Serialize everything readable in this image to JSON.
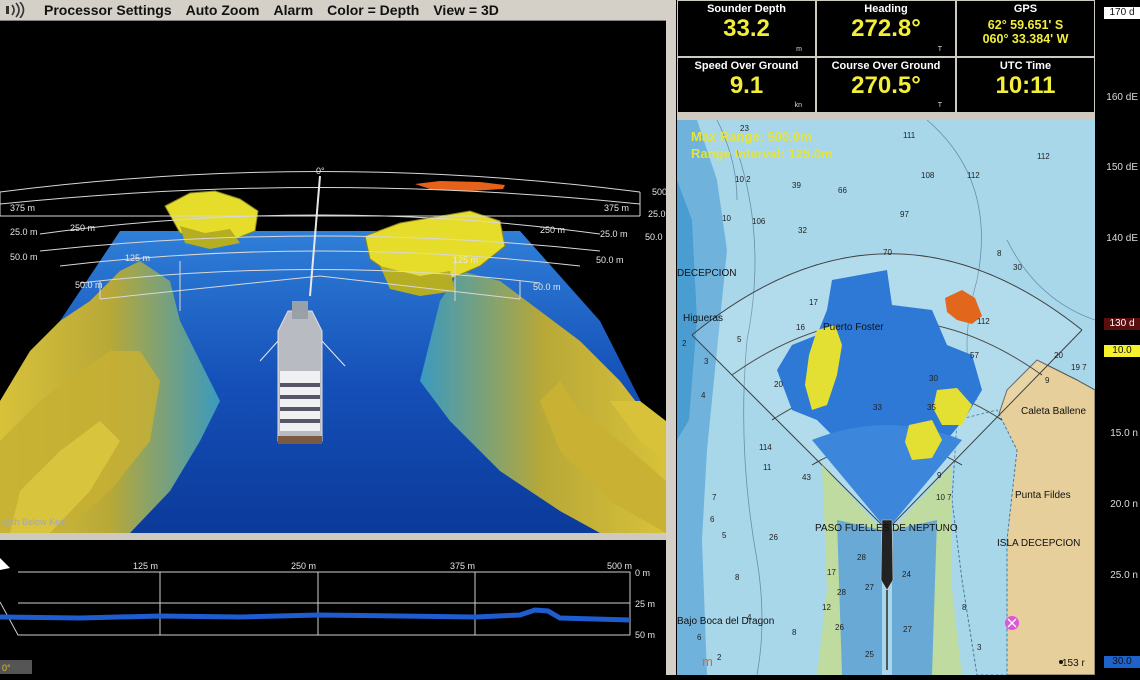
{
  "menu": {
    "signal_icon": "signal-icon",
    "items": [
      "Processor Settings",
      "Auto Zoom",
      "Alarm",
      "Color = Depth",
      "View = 3D"
    ]
  },
  "view3d": {
    "angle_label": "0°",
    "range_labels": [
      "375 m",
      "250 m",
      "125 m",
      "375 m",
      "250 m",
      "125 m"
    ],
    "depth_labels_left": [
      "25.0 m",
      "50.0 m",
      "50.0 m"
    ],
    "depth_labels_right": [
      "25.0",
      "50.0",
      "25.0 m",
      "50.0 m",
      "50.0 m"
    ],
    "top_right_label": "500",
    "overlay_label": "epth Below Keel"
  },
  "profile": {
    "range_ticks": [
      "125 m",
      "250 m",
      "375 m",
      "500 m"
    ],
    "depth_ticks": [
      "0 m",
      "25 m",
      "50 m"
    ],
    "angle_readout": "0°"
  },
  "panels": [
    {
      "label": "Sounder Depth",
      "value": "33.2",
      "unit": "m"
    },
    {
      "label": "Heading",
      "value": "272.8°",
      "unit": "T"
    },
    {
      "label": "GPS",
      "value1": "62° 59.651' S",
      "value2": "060° 33.384' W"
    },
    {
      "label": "Speed Over Ground",
      "value": "9.1",
      "unit": "kn"
    },
    {
      "label": "Course Over Ground",
      "value": "270.5°",
      "unit": "T"
    },
    {
      "label": "UTC Time",
      "value": "10:11"
    }
  ],
  "chart": {
    "max_range": "Max Range: 500.0m",
    "range_interval": "Range Interval: 125.0m",
    "place_names": [
      "DECEPCION",
      "Higueras",
      "Puerto Foster",
      "Caleta Ballene",
      "Punta Fildes",
      "ISLA DECEPCION",
      "PASO FUELLES DE NEPTUNO",
      "Bajo Boca del Dragon"
    ],
    "soundings": [
      "23",
      "111",
      "112",
      "10 2",
      "39",
      "108",
      "66",
      "97",
      "112",
      "10",
      "106",
      "32",
      "70",
      "30",
      "8",
      "20",
      "17",
      "16",
      "112",
      "57",
      "19 7",
      "9",
      "3",
      "5",
      "2",
      "4",
      "20",
      "114",
      "11",
      "7",
      "6",
      "5",
      "43",
      "10 7",
      "9",
      "28",
      "17",
      "12",
      "33",
      "30",
      "35",
      "27",
      "28",
      "26",
      "27",
      "24",
      "25",
      "26",
      "8",
      "6",
      "4",
      "2",
      "8",
      "8",
      "3",
      "153"
    ],
    "bottom_readout": "153 r",
    "m_glyph": "m"
  },
  "scale": {
    "labels": [
      "160 dE",
      "150 dE",
      "140 dE",
      "15.0 n",
      "20.0 n",
      "25.0 n"
    ],
    "top_box": "170 d",
    "red_box": "130 d",
    "yellow_box": "10.0",
    "blue_box": "30.0",
    "colors": {
      "red_box": "#5a0f0f",
      "yellow_box": "#f7f22b",
      "blue_box": "#1f62c9"
    }
  },
  "colors": {
    "accent": "#f2ee3a",
    "water_deep": "#1550b8",
    "chart_sea": "#a8d7ea",
    "land": "#e5cf9a"
  }
}
